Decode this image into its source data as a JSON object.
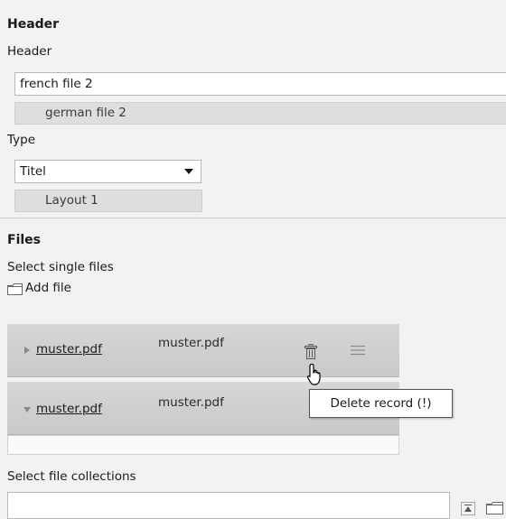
{
  "header_section": {
    "title": "Header",
    "header_label": "Header",
    "header_value": "french file 2",
    "header_reference": "german file 2",
    "type_label": "Type",
    "type_selected": "Titel",
    "type_reference": "Layout 1"
  },
  "files_section": {
    "title": "Files",
    "select_single_label": "Select single files",
    "add_file_label": "Add file",
    "records": [
      {
        "link": "muster.pdf",
        "title": "muster.pdf",
        "expanded": false
      },
      {
        "link": "muster.pdf",
        "title": "muster.pdf",
        "expanded": true
      }
    ],
    "tooltip": "Delete record (!)",
    "select_collections_label": "Select file collections",
    "collections_value": ""
  },
  "icons": {
    "folder": "folder-icon",
    "collapse": "triangle-right-icon",
    "expand": "triangle-down-icon",
    "delete": "trash-icon",
    "drag": "drag-handle-icon",
    "cursor": "hand-pointer-icon"
  }
}
